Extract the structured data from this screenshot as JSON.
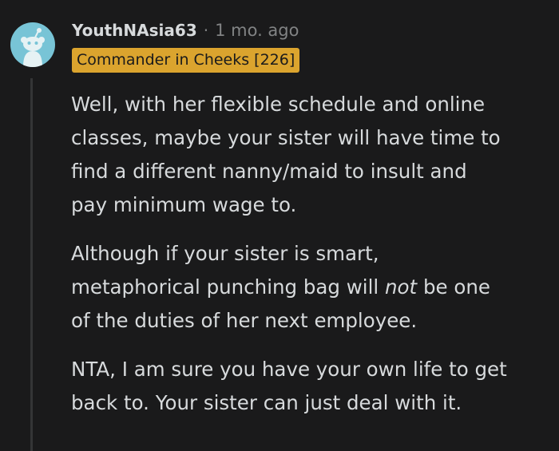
{
  "comment": {
    "author": "YouthNAsia63",
    "separator": "·",
    "time_ago": "1 mo. ago",
    "flair": "Commander in Cheeks [226]",
    "paragraphs": [
      {
        "lines": [
          "Well, with her flexible schedule and online",
          "classes, maybe your sister will have time to",
          "find a different nanny/maid to insult and",
          "pay minimum wage to."
        ]
      },
      {
        "lines": [
          "Although if your sister is smart,",
          "metaphorical punching bag will",
          "not",
          "be one",
          "of the duties of her next employee."
        ]
      },
      {
        "lines": [
          "NTA, I am sure you have your own life to get",
          "back to. Your sister can just deal with it."
        ]
      }
    ]
  },
  "icons": {
    "avatar": "reddit-snoo-avatar-icon"
  },
  "colors": {
    "background": "#1a1a1b",
    "text": "#d7dadc",
    "muted": "#818384",
    "flair_background": "#dba42e",
    "avatar_background": "#78c4d6",
    "thread_line": "#343536"
  }
}
